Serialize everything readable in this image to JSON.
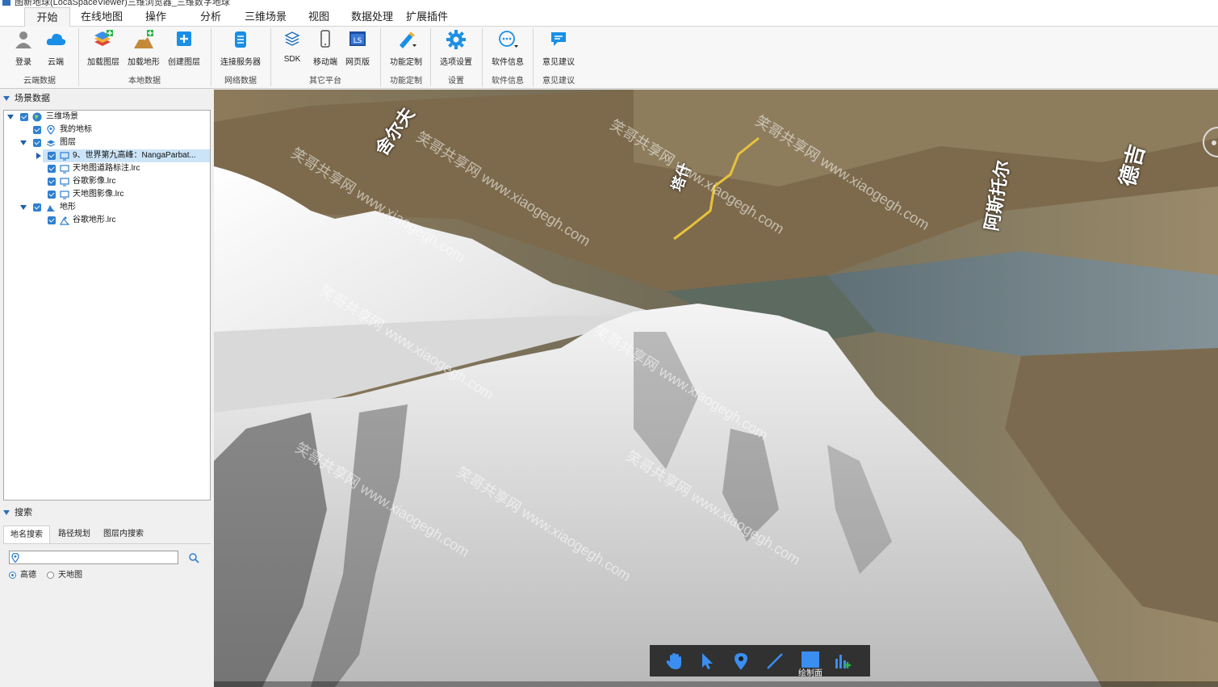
{
  "window": {
    "title": "图新地球(LocaSpaceViewer)三维浏览器_三维数字地球"
  },
  "menu": {
    "tabs": [
      {
        "label": "开始",
        "active": true
      },
      {
        "label": "在线地图"
      },
      {
        "label": "操作"
      },
      {
        "label": "分析"
      },
      {
        "label": "三维场景"
      },
      {
        "label": "视图"
      },
      {
        "label": "数据处理"
      },
      {
        "label": "扩展插件"
      }
    ]
  },
  "ribbon": {
    "buttons": {
      "login": "登录",
      "cloud": "云端",
      "load_layer": "加载图层",
      "load_terrain": "加载地形",
      "create_layer": "创建图层",
      "connect_server": "连接服务器",
      "sdk": "SDK",
      "mobile": "移动端",
      "web": "网页版",
      "customize": "功能定制",
      "options": "选项设置",
      "software_info": "软件信息",
      "feedback": "意见建议"
    },
    "groups": {
      "cloud_data": "云端数据",
      "local_data": "本地数据",
      "network_data": "网络数据",
      "other_platform": "其它平台",
      "customize": "功能定制",
      "settings": "设置",
      "software_info": "软件信息",
      "feedback": "意见建议"
    },
    "icons": {
      "login": "user-icon",
      "cloud": "cloud-icon",
      "load_layer": "layers-add-icon",
      "load_terrain": "terrain-add-icon",
      "create_layer": "plus-square-icon",
      "connect_server": "database-icon",
      "sdk": "sdk-stack-icon",
      "mobile": "phone-icon",
      "web": "web-page-icon",
      "customize": "pen-brush-icon",
      "options": "gear-icon",
      "software_info": "info-dots-icon",
      "feedback": "chat-bubble-icon"
    }
  },
  "scene_panel": {
    "title": "场景数据",
    "tree": {
      "root": "三维场景",
      "my_placemarks": "我的地标",
      "layers_folder": "图层",
      "layer_items": [
        "9、世界第九高峰：NangaParbat...",
        "天地图道路标注.lrc",
        "谷歌影像.lrc",
        "天地图影像.lrc"
      ],
      "terrain_folder": "地形",
      "terrain_items": [
        "谷歌地形.lrc"
      ]
    }
  },
  "search_panel": {
    "title": "搜索",
    "tabs": [
      "地名搜索",
      "路径规划",
      "图层内搜索"
    ],
    "input_value": "",
    "providers": [
      {
        "label": "高德",
        "selected": true
      },
      {
        "label": "天地图",
        "selected": false
      }
    ]
  },
  "viewport": {
    "watermark": "笑哥共享网 www.xiaogegh.com",
    "map_labels": [
      "舍尔夫",
      "塔什",
      "阿斯托尔",
      "德吉"
    ],
    "draw_toolbar": {
      "tools": [
        "hand-pan-icon",
        "pointer-icon",
        "placemark-icon",
        "line-icon",
        "polygon-icon",
        "chart-icon"
      ],
      "tooltip": "绘制面"
    }
  }
}
